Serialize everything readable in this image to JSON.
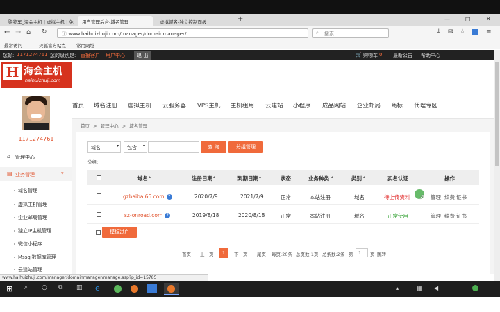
{
  "browser": {
    "tabs": [
      {
        "label": "购物车_海会主机 | 虚拟主机 | 免"
      },
      {
        "label": "用户管理后台-域名管理"
      },
      {
        "label": "虚拟域名-独立控制面板"
      }
    ],
    "new_tab": "+",
    "url": "www.haihuizhuji.com/manager/domainmanager/",
    "search_placeholder": "搜索",
    "bookmarks": [
      "最常访问",
      "火狐官方站点",
      "常用网址"
    ],
    "window_controls": [
      "—",
      "□",
      "✕"
    ]
  },
  "site_bar": {
    "greeting": "您好:",
    "user_id": "1171274761",
    "level_label": "您的级别是:",
    "level_value": "直接客户",
    "manager_center": "用户中心",
    "logout": "退 出",
    "cart": "购物车",
    "cart_count": "0",
    "announcements": "最新公告",
    "help": "帮助中心"
  },
  "header": {
    "logo_text": "海会主机",
    "logo_sub": "haihuizhuji.com"
  },
  "main_nav": [
    "首页",
    "域名注册",
    "虚拟主机",
    "云服务器",
    "VPS主机",
    "主机租用",
    "云建站",
    "小程序",
    "成品网站",
    "企业邮局",
    "商标",
    "代理专区"
  ],
  "sidebar": {
    "user_id": "1171274761",
    "manage_center": "管理中心",
    "business_label": "业务管理",
    "items": [
      "域名管理",
      "虚拟主机管理",
      "企业邮局管理",
      "独立IP主机管理",
      "微信小程序",
      "Mssql数据库管理",
      "云建站管理"
    ]
  },
  "breadcrumb": {
    "home": "首页",
    "sep": ">",
    "center": "管理中心",
    "current": "域名管理"
  },
  "filter": {
    "field_select": "域名",
    "match_select": "包含",
    "search_button": "查 询",
    "category_button": "分组管理",
    "group_label": "分组:"
  },
  "table": {
    "headers": [
      "域名",
      "注册日期",
      "到期日期",
      "状态",
      "业务种类",
      "类别",
      "实名认证",
      "操作"
    ],
    "rows": [
      {
        "domain": "gzbaibai66.com",
        "reg": "2020/7/9",
        "exp": "2021/7/9",
        "status": "正常",
        "kind": "本站注册",
        "type": "域名",
        "verify": "待上传资料",
        "verify_color": "#e02020",
        "actions": [
          "管理",
          "续费",
          "证书"
        ]
      },
      {
        "domain": "sz-onroad.com",
        "reg": "2019/8/18",
        "exp": "2020/8/18",
        "status": "正常",
        "kind": "本站注册",
        "type": "域名",
        "verify": "正常使用",
        "verify_color": "#2a9d2a",
        "actions": [
          "管理",
          "续费",
          "证书"
        ]
      }
    ],
    "batch_button": "模板过户"
  },
  "pagination": {
    "first": "首页",
    "prev": "上一页",
    "current": "1",
    "next": "下一页",
    "last": "尾页",
    "per_page": "每页:20条",
    "total_pages": "总页数:1页",
    "total_count": "总条数:2条",
    "goto_label": "第",
    "goto_value": "1",
    "page_unit": "页",
    "jump": "跳转"
  },
  "status_url": "www.haihuizhuji.com/manager/domainmanager/manage.asp?p_id=15785",
  "colors": {
    "accent": "#f06a3b",
    "link": "#e0502a",
    "dark_bar": "#222222"
  }
}
